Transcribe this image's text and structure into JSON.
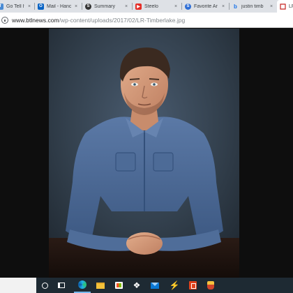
{
  "browser": {
    "tabs": [
      {
        "title": "Go Tell It O",
        "favicon": "facebook-icon",
        "active": false
      },
      {
        "title": "Mail - Hanc",
        "favicon": "outlook-icon",
        "active": false
      },
      {
        "title": "Summary",
        "favicon": "summary-icon",
        "active": false
      },
      {
        "title": "Steelo",
        "favicon": "youtube-icon",
        "active": false
      },
      {
        "title": "Favorite Ar",
        "favicon": "site-icon",
        "active": false
      },
      {
        "title": "justin timb",
        "favicon": "bing-icon",
        "active": false
      },
      {
        "title": "LR",
        "favicon": "image-icon",
        "active": true
      }
    ],
    "close_glyph": "×",
    "address": {
      "domain": "www.btlnews.com",
      "path": "/wp-content/uploads/2017/02/LR-Timberlake.jpg"
    }
  },
  "image_viewer": {
    "image_alt": "LR-Timberlake.jpg",
    "background_color": "#0e0e0e"
  },
  "taskbar": {
    "icons": [
      "search-box",
      "cortana-icon",
      "task-view-icon",
      "edge-icon",
      "file-explorer-icon",
      "store-icon",
      "dropbox-icon",
      "mail-icon",
      "lightning-icon",
      "office-icon",
      "game-icon"
    ],
    "dropbox_glyph": "❖",
    "bolt_glyph": "⚡"
  },
  "colors": {
    "tabstrip": "#dee1e6",
    "taskbar": "#1e2a33",
    "edge_accent": "#76b9ed"
  }
}
